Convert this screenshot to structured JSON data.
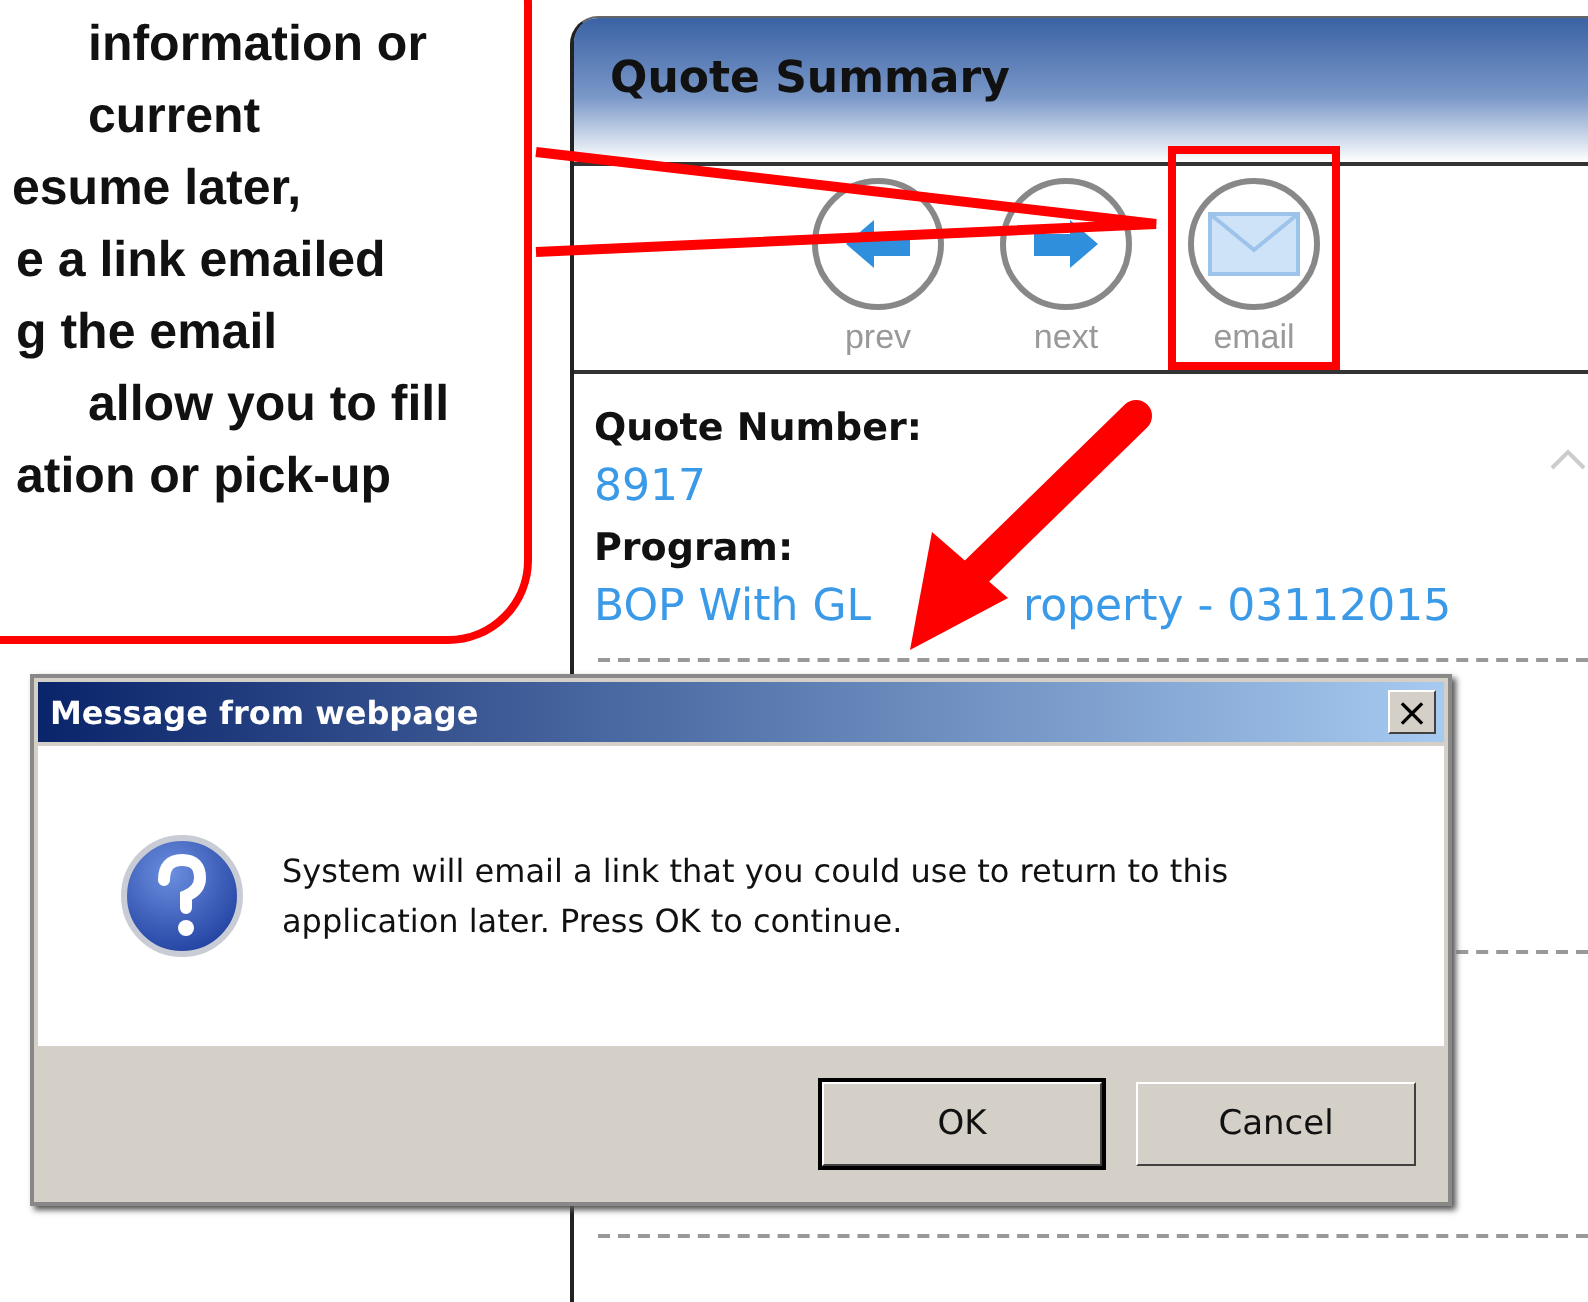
{
  "callout": {
    "lines": [
      "information or",
      "current",
      "esume later,",
      "e a link emailed",
      "g the email",
      "allow you to fill",
      "ation or pick-up"
    ]
  },
  "panel": {
    "title": "Quote Summary",
    "toolbar": [
      {
        "label": "prev",
        "kind": "prev",
        "highlighted": false
      },
      {
        "label": "next",
        "kind": "next",
        "highlighted": false
      },
      {
        "label": "email",
        "kind": "email",
        "highlighted": true
      }
    ],
    "fields": [
      {
        "label": "Quote Number:",
        "values": [
          "8917"
        ]
      },
      {
        "label": "Program:",
        "values": [
          "BOP With GL",
          "roperty - 03112015"
        ]
      }
    ]
  },
  "dialog": {
    "title": "Message from webpage",
    "close": "×",
    "message": "System will email a link that you could use to return to this application later. Press OK to continue.",
    "buttons": [
      {
        "label": "OK",
        "default": true
      },
      {
        "label": "Cancel",
        "default": false
      }
    ]
  }
}
